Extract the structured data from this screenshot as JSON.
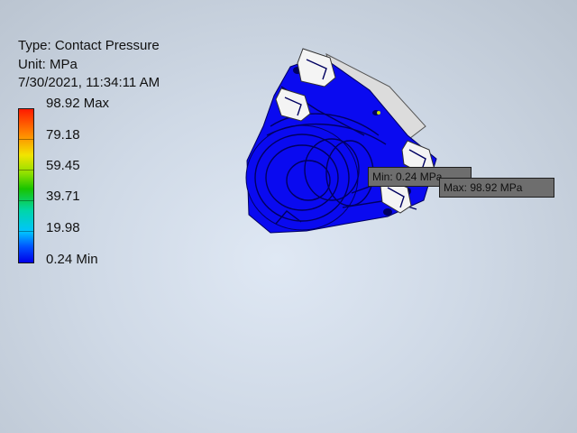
{
  "result_info": {
    "type_line": "Type: Contact Pressure",
    "unit_line": "Unit: MPa",
    "timestamp": "7/30/2021, 11:34:11 AM"
  },
  "legend": {
    "values": [
      "98.92 Max",
      "79.18",
      "59.45",
      "39.71",
      "19.98",
      "0.24 Min"
    ],
    "max_value": 98.92,
    "min_value": 0.24,
    "unit": "MPa",
    "colors": [
      "#ff1a00",
      "#ff8c00",
      "#f2e400",
      "#18c400",
      "#00d6a8",
      "#00c4ff",
      "#0000e8"
    ]
  },
  "probes": {
    "min_label": "Min: 0.24 MPa",
    "max_label": "Max: 98.92 MPa"
  },
  "model": {
    "body_color": "#0a0af0",
    "edge_color": "#000060",
    "clip_color": "#f4f4f4"
  }
}
